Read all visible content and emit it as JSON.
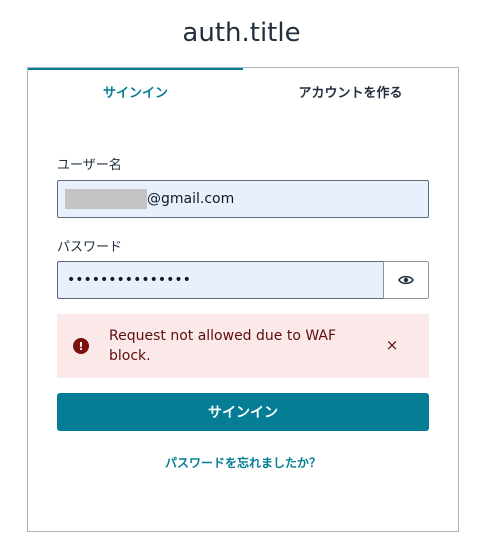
{
  "page": {
    "title": "auth.title"
  },
  "tabs": [
    {
      "label": "サインイン",
      "active": true
    },
    {
      "label": "アカウントを作る",
      "active": false
    }
  ],
  "form": {
    "username_label": "ユーザー名",
    "username_value_suffix": "@gmail.com",
    "password_label": "パスワード",
    "password_value": "•••••••••••••••",
    "show_password_icon": "eye-icon"
  },
  "alert": {
    "icon": "error-icon",
    "message": "Request not allowed due to WAF block.",
    "close": "×"
  },
  "submit_label": "サインイン",
  "forgot_password": "パスワードを忘れましたか？",
  "colors": {
    "accent": "#047d95",
    "alert_bg": "#fae9e8",
    "alert_text": "#5c0e0e",
    "input_bg": "#e8f0fe"
  }
}
